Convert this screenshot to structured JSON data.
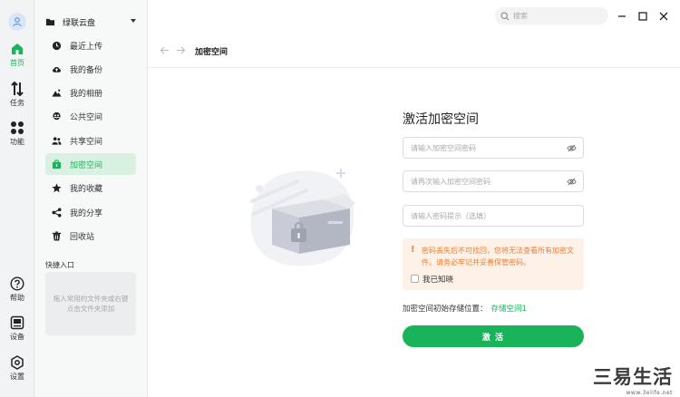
{
  "rail": {
    "items": [
      {
        "label": "首页"
      },
      {
        "label": "任务"
      },
      {
        "label": "功能"
      },
      {
        "label": "帮助"
      },
      {
        "label": "设备"
      },
      {
        "label": "设置"
      }
    ]
  },
  "sidebar": {
    "drive": "绿联云盘",
    "items": [
      {
        "label": "最近上传"
      },
      {
        "label": "我的备份"
      },
      {
        "label": "我的相册"
      },
      {
        "label": "公共空间"
      },
      {
        "label": "共享空间"
      },
      {
        "label": "加密空间"
      },
      {
        "label": "我的收藏"
      },
      {
        "label": "我的分享"
      },
      {
        "label": "回收站"
      }
    ],
    "quick_title": "快捷入口",
    "quick_hint": "拖入常用的文件夹或右键点击文件夹添加"
  },
  "topbar": {
    "search_placeholder": "搜索"
  },
  "crumb": {
    "title": "加密空间"
  },
  "form": {
    "title": "激活加密空间",
    "password_placeholder": "请输入加密空间密码",
    "confirm_placeholder": "请再次输入加密空间密码",
    "hint_placeholder": "请输入密码提示（选填）",
    "warning": "密码丢失后不可找回，您将无法查看所有加密文件。请务必牢记并妥善保管密码。",
    "ack_label": "我已知晓",
    "location_label": "加密空间初始存储位置：",
    "location_value": "存储空间1",
    "activate_label": "激 活"
  },
  "watermark": {
    "text": "三易生活",
    "url": "www.3elife.net"
  },
  "colors": {
    "accent": "#19b35a",
    "warning": "#f07e2d",
    "warning_bg": "#fdf1e8"
  }
}
